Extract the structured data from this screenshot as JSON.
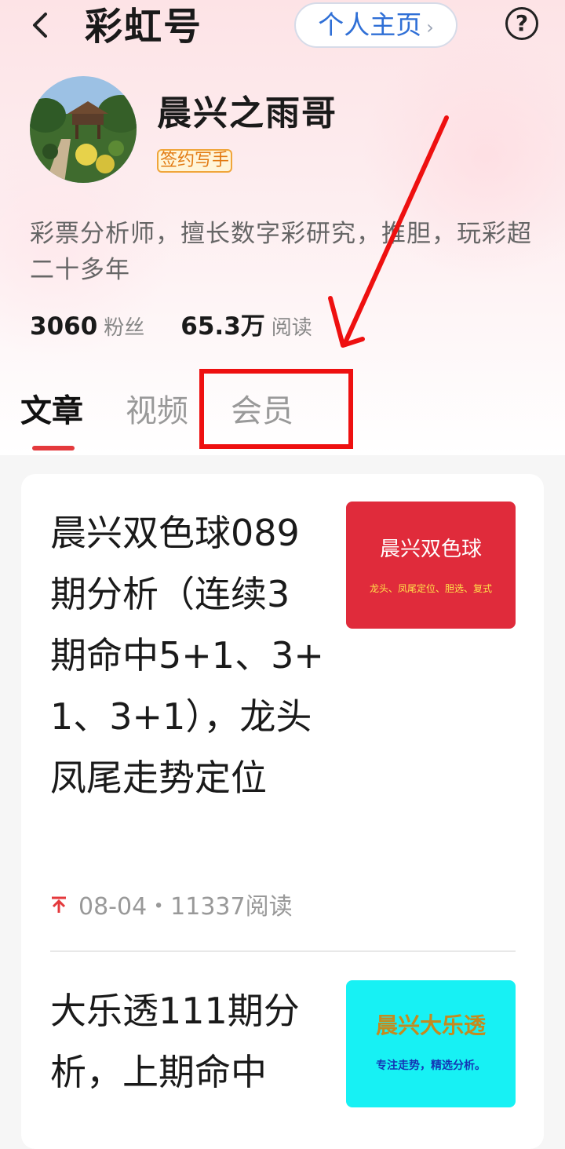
{
  "header": {
    "back_icon": "chevron-left-icon",
    "title": "彩虹号",
    "home_button": "个人主页",
    "help_icon": "help-circle-icon"
  },
  "profile": {
    "name": "晨兴之雨哥",
    "badge": "签约写手",
    "bio": "彩票分析师，擅长数字彩研究，推胆，玩彩超二十多年",
    "followers_value": "3060",
    "followers_label": "粉丝",
    "reads_value": "65.3万",
    "reads_label": "阅读"
  },
  "tabs": [
    {
      "label": "文章",
      "active": true
    },
    {
      "label": "视频",
      "active": false
    },
    {
      "label": "会员",
      "active": false
    }
  ],
  "annotation": {
    "color": "#ee1010"
  },
  "articles": [
    {
      "title": "晨兴双色球089期分析（连续3期命中5+1、3+1、3+1），龙头凤尾走势定位",
      "meta": "08-04・11337阅读",
      "pinned": true,
      "thumb_title": "晨兴双色球",
      "thumb_sub": "龙头、凤尾定位、胆选、复式",
      "thumb_color": "#e02b3b"
    },
    {
      "title": "大乐透111期分析，上期命中",
      "thumb_title": "晨兴大乐透",
      "thumb_sub": "专注走势，精选分析。",
      "thumb_color": "#17f1f4"
    }
  ],
  "colors": {
    "accent": "#e4393c",
    "link": "#2f6fd6"
  }
}
